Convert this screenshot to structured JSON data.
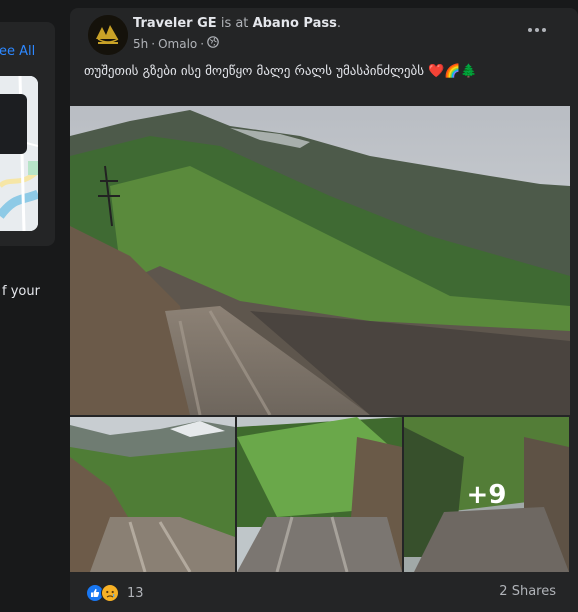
{
  "left_panel": {
    "see_all_label": "ee All",
    "truncated_text": "f your"
  },
  "post": {
    "author": "Traveler GE",
    "is_at_text": "is at",
    "location": "Abano Pass",
    "time": "5h",
    "place": "Omalo",
    "audience_icon": "globe-icon",
    "text": "თუშეთის გზები ისე მოეწყო  მალე რალს უმასპინძლებს ❤️🌈🌲",
    "more_photos": "+9",
    "reactions": [
      "like-icon",
      "sad-icon"
    ],
    "reaction_count": "13",
    "shares": "2 Shares"
  },
  "colors": {
    "background": "#18191a",
    "card": "#242526",
    "link": "#2d88ff",
    "text": "#e4e6eb",
    "muted": "#b0b3b8"
  }
}
